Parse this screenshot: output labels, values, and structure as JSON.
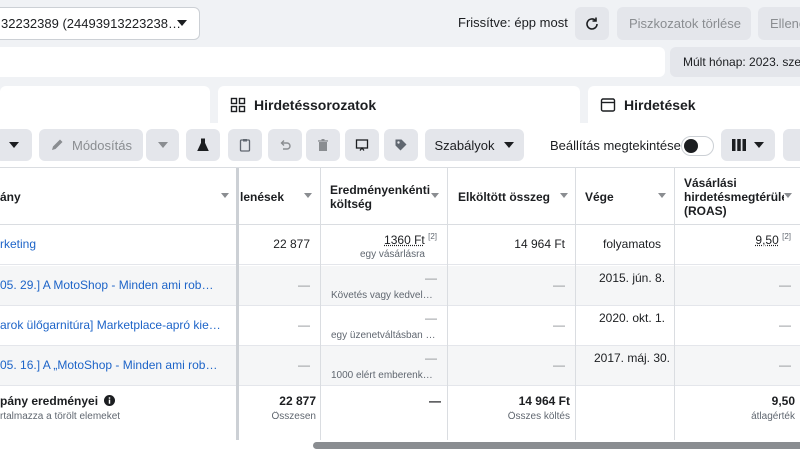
{
  "topbar": {
    "account_label": "32232389 (24493913223238…",
    "refresh_status": "Frissítve: épp most",
    "clear_drafts": "Piszkozatok törlése",
    "check": "Ellenő"
  },
  "date_range": "Múlt hónap: 2023. sze",
  "tabs": {
    "adsets": "Hirdetéssorozatok",
    "ads": "Hirdetések"
  },
  "toolbar": {
    "edit": "Módosítás",
    "rules": "Szabályok",
    "preview_setup": "Beállítás megtekintése"
  },
  "table": {
    "headers": {
      "name": "ány",
      "results": "lenések",
      "cost_per_result": "Eredményenkénti költség",
      "amount_spent": "Elköltött összeg",
      "ends": "Vége",
      "roas": "Vásárlási hirdetésmegtérülé (ROAS)"
    },
    "rows": [
      {
        "name": "rketing",
        "results": "22 877",
        "cost": "1360 Ft",
        "cost_sup": "[2]",
        "cost_sub": "egy vásárlásra",
        "spent": "14 964 Ft",
        "ends": "folyamatos",
        "roas": "9,50",
        "roas_sup": "[2]"
      },
      {
        "name": "05. 29.] A MotoShop - Minden ami rob…",
        "results": "—",
        "cost": "—",
        "cost_sub": "Követés vagy kedvel…",
        "spent": "—",
        "ends": "2015. jún. 8.",
        "roas": "—"
      },
      {
        "name": "arok ülőgarnitúra] Marketplace-apró kie…",
        "results": "—",
        "cost": "—",
        "cost_sub": "egy üzenetváltásban …",
        "spent": "—",
        "ends": "2020. okt. 1.",
        "roas": "—"
      },
      {
        "name": "05. 16.] A „MotoShop - Minden ami rob…",
        "results": "—",
        "cost": "—",
        "cost_sub": "1000 elért emberenk…",
        "spent": "—",
        "ends": "2017. máj. 30.",
        "roas": "—"
      }
    ],
    "totals": {
      "name": "pány eredményei",
      "name_sub": "rtalmazza a törölt elemeket",
      "results": "22 877",
      "results_sub": "Összesen",
      "cost": "—",
      "spent": "14 964 Ft",
      "spent_sub": "Összes költés",
      "roas": "9,50",
      "roas_sub": "átlagérték"
    }
  },
  "icons": [
    "chevron-down-icon",
    "refresh-icon",
    "grid-icon",
    "ad-icon",
    "pencil-icon",
    "flask-icon",
    "clipboard-icon",
    "undo-icon",
    "trash-icon",
    "preview-icon",
    "tag-icon",
    "columns-icon",
    "info-icon"
  ]
}
